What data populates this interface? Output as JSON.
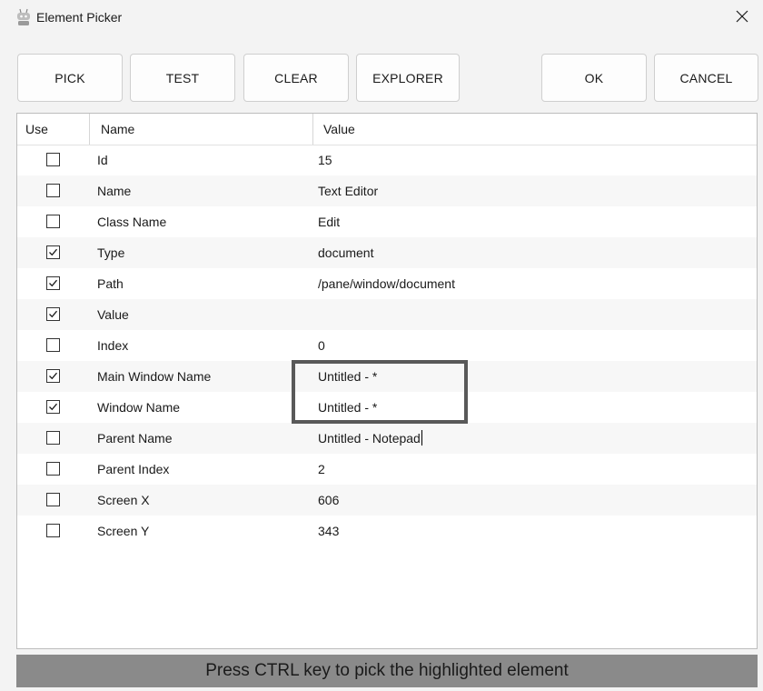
{
  "window": {
    "title": "Element Picker",
    "icon": "robot-icon",
    "close_icon": "close-icon"
  },
  "toolbar": {
    "pick": "PICK",
    "test": "TEST",
    "clear": "CLEAR",
    "explorer": "EXPLORER",
    "ok": "OK",
    "cancel": "CANCEL"
  },
  "grid": {
    "columns": [
      "Use",
      "Name",
      "Value"
    ],
    "rows": [
      {
        "use": false,
        "name": "Id",
        "value": "15"
      },
      {
        "use": false,
        "name": "Name",
        "value": "Text Editor"
      },
      {
        "use": false,
        "name": "Class Name",
        "value": "Edit"
      },
      {
        "use": true,
        "name": "Type",
        "value": "document"
      },
      {
        "use": true,
        "name": "Path",
        "value": "/pane/window/document"
      },
      {
        "use": true,
        "name": "Value",
        "value": ""
      },
      {
        "use": false,
        "name": "Index",
        "value": "0"
      },
      {
        "use": true,
        "name": "Main Window Name",
        "value": "Untitled - *"
      },
      {
        "use": true,
        "name": "Window Name",
        "value": "Untitled - *"
      },
      {
        "use": false,
        "name": "Parent Name",
        "value": "Untitled - Notepad"
      },
      {
        "use": false,
        "name": "Parent Index",
        "value": "2"
      },
      {
        "use": false,
        "name": "Screen X",
        "value": "606"
      },
      {
        "use": false,
        "name": "Screen Y",
        "value": "343"
      }
    ]
  },
  "status": {
    "text": "Press CTRL key to pick the highlighted element"
  },
  "colors": {
    "background": "#f3f3f3",
    "status_bar": "#8a8a8a",
    "highlight_border": "#595959"
  }
}
